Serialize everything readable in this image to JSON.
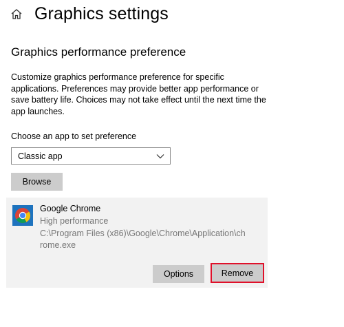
{
  "header": {
    "home_icon": "home-icon",
    "title": "Graphics settings"
  },
  "section": {
    "title": "Graphics performance preference",
    "description": "Customize graphics performance preference for specific applications. Preferences may provide better app performance or save battery life. Choices may not take effect until the next time the app launches."
  },
  "app_picker": {
    "label": "Choose an app to set preference",
    "selected": "Classic app",
    "dropdown_icon": "chevron-down-icon",
    "browse_label": "Browse"
  },
  "apps": [
    {
      "icon": "chrome-icon",
      "name": "Google Chrome",
      "preference": "High performance",
      "path": "C:\\Program Files (x86)\\Google\\Chrome\\Application\\chrome.exe",
      "options_label": "Options",
      "remove_label": "Remove"
    }
  ],
  "colors": {
    "button_bg": "#cccccc",
    "card_bg": "#f2f2f2",
    "secondary_text": "#767676",
    "highlight_border": "#e0102a"
  }
}
